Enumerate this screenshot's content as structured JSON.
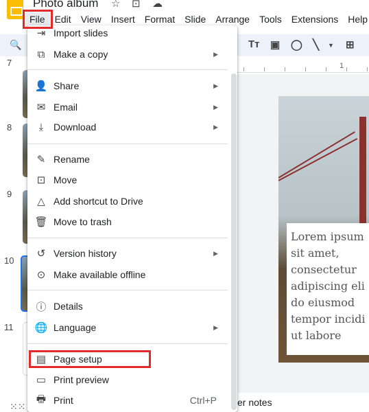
{
  "app": {
    "title": "Photo album"
  },
  "menubar": [
    "File",
    "Edit",
    "View",
    "Insert",
    "Format",
    "Slide",
    "Arrange",
    "Tools",
    "Extensions",
    "Help"
  ],
  "filmstrip": {
    "slide_numbers": [
      "7",
      "8",
      "9",
      "10",
      "11"
    ]
  },
  "ruler": {
    "label": "1"
  },
  "slide": {
    "text_lines": "Lorem ipsum\nsit amet,\nconsectetur\nadipiscing eli\ndo eiusmod\ntempor incidi\nut labore"
  },
  "notes": {
    "label": "er notes"
  },
  "file_menu": {
    "items": [
      {
        "label": "Import slides",
        "icon": "import-icon",
        "arrow": false
      },
      {
        "label": "Make a copy",
        "icon": "copy-icon",
        "arrow": true
      },
      {
        "label": "Share",
        "icon": "person-add-icon",
        "arrow": true
      },
      {
        "label": "Email",
        "icon": "email-icon",
        "arrow": true
      },
      {
        "label": "Download",
        "icon": "download-icon",
        "arrow": true
      },
      {
        "label": "Rename",
        "icon": "rename-icon",
        "arrow": false
      },
      {
        "label": "Move",
        "icon": "folder-move-icon",
        "arrow": false
      },
      {
        "label": "Add shortcut to Drive",
        "icon": "drive-shortcut-icon",
        "arrow": false
      },
      {
        "label": "Move to trash",
        "icon": "trash-icon",
        "arrow": false
      },
      {
        "label": "Version history",
        "icon": "history-icon",
        "arrow": true
      },
      {
        "label": "Make available offline",
        "icon": "offline-icon",
        "arrow": false
      },
      {
        "label": "Details",
        "icon": "info-icon",
        "arrow": false
      },
      {
        "label": "Language",
        "icon": "globe-icon",
        "arrow": true
      },
      {
        "label": "Page setup",
        "icon": "page-icon",
        "arrow": false
      },
      {
        "label": "Print preview",
        "icon": "preview-icon",
        "arrow": false
      },
      {
        "label": "Print",
        "icon": "print-icon",
        "arrow": false,
        "shortcut": "Ctrl+P"
      }
    ]
  },
  "highlight_color": "#e32a2a",
  "accent_color": "#1a73e8"
}
